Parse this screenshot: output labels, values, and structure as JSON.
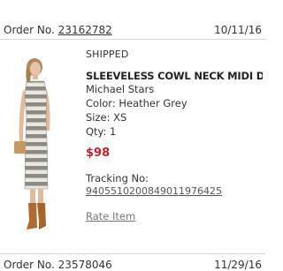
{
  "order": {
    "label": "Order No.",
    "number": "23162782",
    "date": "10/11/16"
  },
  "item": {
    "status": "SHIPPED",
    "title": "SLEEVELESS COWL NECK MIDI DRE...",
    "brand": "Michael Stars",
    "color_line": "Color: Heather Grey",
    "size_line": "Size: XS",
    "qty_line": "Qty: 1",
    "price": "$98",
    "price_color": "#cc1f2a",
    "tracking_label": "Tracking No:",
    "tracking_number": "9405510200849011976425",
    "rate_label": "Rate Item"
  },
  "next_order": {
    "label": "Order No.",
    "number": "23578046",
    "date": "11/29/16"
  }
}
